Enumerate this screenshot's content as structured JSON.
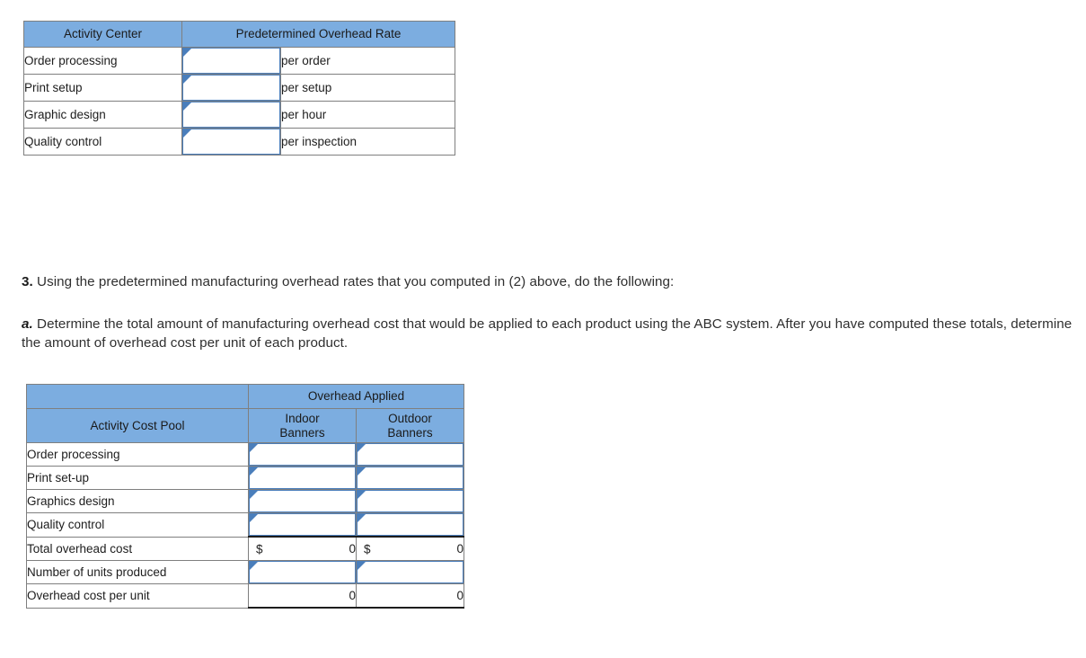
{
  "table_overhead_rate": {
    "name": "Predetermined Overhead Rate Table",
    "headers": {
      "col1": "Activity Center",
      "col2": "Predetermined Overhead Rate"
    },
    "rows": [
      {
        "activity_center": "Order processing",
        "rate_value": "",
        "unit": "per order"
      },
      {
        "activity_center": "Print setup",
        "rate_value": "",
        "unit": "per setup"
      },
      {
        "activity_center": "Graphic design",
        "rate_value": "",
        "unit": "per hour"
      },
      {
        "activity_center": "Quality control",
        "rate_value": "",
        "unit": "per inspection"
      }
    ]
  },
  "paragraph_3": {
    "marker": "3.",
    "text": " Using the predetermined manufacturing overhead rates that you computed in (2) above, do the following:"
  },
  "paragraph_a": {
    "marker": "a.",
    "text": " Determine the total amount of manufacturing overhead cost that would be applied to each product using the ABC system. After you have computed these totals, determine the amount of overhead cost per unit of each product."
  },
  "table_overhead_applied": {
    "name": "Overhead Applied Table",
    "headers": {
      "corner": "",
      "group": "Overhead Applied",
      "col1": "Activity Cost Pool",
      "col2_line1": "Indoor",
      "col2_line2": "Banners",
      "col3_line1": "Outdoor",
      "col3_line2": "Banners"
    },
    "rows": [
      {
        "label": "Order processing",
        "indoor": "",
        "outdoor": "",
        "type": "input"
      },
      {
        "label": "Print set-up",
        "indoor": "",
        "outdoor": "",
        "type": "input"
      },
      {
        "label": "Graphics design",
        "indoor": "",
        "outdoor": "",
        "type": "input"
      },
      {
        "label": "Quality control",
        "indoor": "",
        "outdoor": "",
        "type": "input"
      },
      {
        "label": "Total overhead cost",
        "indoor": "0",
        "outdoor": "0",
        "currency": "$",
        "type": "total"
      },
      {
        "label": "Number of units produced",
        "indoor": "",
        "outdoor": "",
        "type": "input"
      },
      {
        "label": "Overhead cost per unit",
        "indoor": "0",
        "outdoor": "0",
        "type": "result"
      }
    ]
  },
  "colors": {
    "header_blue": "#7cade0",
    "input_border": "#4a7ebb",
    "table_border": "#7f7f7f",
    "text": "#2f2f2f"
  }
}
